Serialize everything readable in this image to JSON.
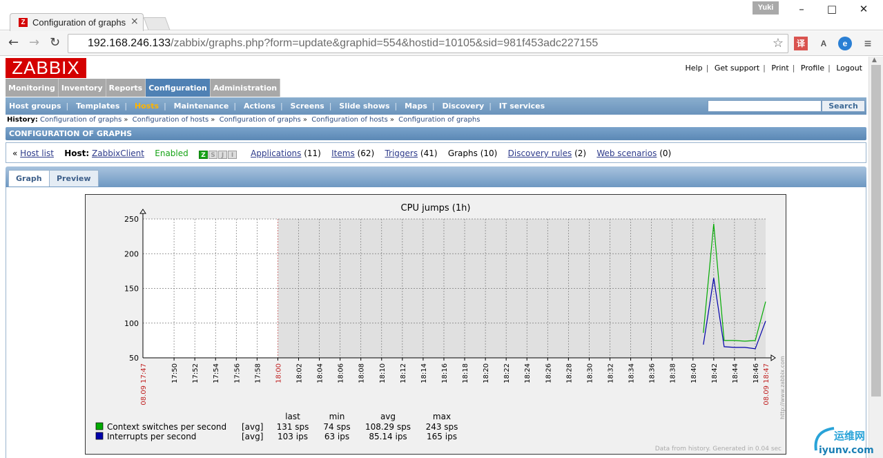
{
  "browser": {
    "tab_title": "Configuration of graphs",
    "tab_close": "×",
    "favicon_letter": "Z",
    "user_name": "Yuki",
    "url_host": "192.168.246.133",
    "url_path": "/zabbix/graphs.php?form=update&graphid=554&hostid=10105&sid=981f453adc227155",
    "ext_translate": "译",
    "ext_tools": "A",
    "ext_edge": "e",
    "menu_icon": "≡"
  },
  "header": {
    "logo": "ZABBIX",
    "links": [
      "Help",
      "Get support",
      "Print",
      "Profile",
      "Logout"
    ]
  },
  "main_menu": [
    "Monitoring",
    "Inventory",
    "Reports",
    "Configuration",
    "Administration"
  ],
  "main_menu_active": "Configuration",
  "sub_menu": [
    "Host groups",
    "Templates",
    "Hosts",
    "Maintenance",
    "Actions",
    "Screens",
    "Slide shows",
    "Maps",
    "Discovery",
    "IT services"
  ],
  "sub_menu_active": "Hosts",
  "search": {
    "button": "Search",
    "value": ""
  },
  "history": {
    "label": "History:",
    "items": [
      "Configuration of graphs",
      "Configuration of hosts",
      "Configuration of graphs",
      "Configuration of hosts",
      "Configuration of graphs"
    ],
    "sep": "»"
  },
  "section_title": "CONFIGURATION OF GRAPHS",
  "host_bar": {
    "back": "«",
    "host_list": "Host list",
    "host_label": "Host:",
    "host_name": "ZabbixClient",
    "status": "Enabled",
    "availability": [
      "Z",
      "S",
      "J",
      "I"
    ],
    "applications": "Applications",
    "applications_count": "(11)",
    "items": "Items",
    "items_count": "(62)",
    "triggers": "Triggers",
    "triggers_count": "(41)",
    "graphs": "Graphs",
    "graphs_count": "(10)",
    "discovery": "Discovery rules",
    "discovery_count": "(2)",
    "web": "Web scenarios",
    "web_count": "(0)"
  },
  "tabs": [
    "Graph",
    "Preview"
  ],
  "tab_selected": "Preview",
  "chart_data": {
    "type": "line",
    "title": "CPU jumps (1h)",
    "ylim": [
      50,
      250
    ],
    "yticks": [
      50,
      100,
      150,
      200,
      250
    ],
    "x_start_label": "08.09 17:47",
    "x_end_label": "08.09 18:47",
    "x_tick_labels": [
      "17:50",
      "17:52",
      "17:54",
      "17:56",
      "17:58",
      "18:00",
      "18:02",
      "18:04",
      "18:06",
      "18:08",
      "18:10",
      "18:12",
      "18:14",
      "18:16",
      "18:18",
      "18:20",
      "18:22",
      "18:24",
      "18:26",
      "18:28",
      "18:30",
      "18:32",
      "18:34",
      "18:36",
      "18:38",
      "18:40",
      "18:42",
      "18:44",
      "18:46"
    ],
    "highlight_tick": "18:00",
    "no_data_until": "18:00",
    "series": [
      {
        "name": "Context switches per second",
        "color": "#00aa00",
        "x": [
          "18:41",
          "18:42",
          "18:43",
          "18:44",
          "18:45",
          "18:46",
          "18:47"
        ],
        "values": [
          86,
          243,
          75,
          75,
          74,
          75,
          131
        ]
      },
      {
        "name": "Interrupts per second",
        "color": "#0000aa",
        "x": [
          "18:41",
          "18:42",
          "18:43",
          "18:44",
          "18:45",
          "18:46",
          "18:47"
        ],
        "values": [
          69,
          165,
          66,
          65,
          65,
          63,
          103
        ]
      }
    ],
    "legend_headers": [
      "last",
      "min",
      "avg",
      "max"
    ],
    "legend_rows": [
      {
        "func": "[avg]",
        "last": "131 sps",
        "min": "74 sps",
        "avg": "108.29 sps",
        "max": "243 sps"
      },
      {
        "func": "[avg]",
        "last": "103 ips",
        "min": "63 ips",
        "avg": "85.14 ips",
        "max": "165 ips"
      }
    ],
    "side_text": "http://www.zabbix.com",
    "footer": "Data from history. Generated in 0.04 sec"
  },
  "watermark": {
    "cn": "运维网",
    "en": "iyunv.com"
  }
}
